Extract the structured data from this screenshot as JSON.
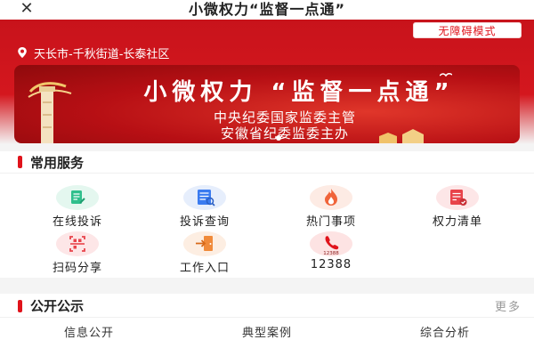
{
  "header": {
    "close_icon": "close-icon",
    "title": "小微权力“监督一点通”",
    "menu_icon": "more-dots-icon"
  },
  "toolbar": {
    "accessibility_label": "无障碍模式"
  },
  "location": {
    "icon": "location-pin-icon",
    "text": "天长市-千秋街道-长泰社区"
  },
  "banner": {
    "title": "小微权力 “监督一点通”",
    "subtitle_line1": "中央纪委国家监委主管",
    "subtitle_line2": "安徽省纪委监委主办",
    "active_slide": 1,
    "slide_count": 1
  },
  "services": {
    "section_title": "常用服务",
    "items": [
      {
        "label": "在线投诉",
        "icon": "complaint-form-icon",
        "color": "#2fbf8c",
        "bg": "#e4f7ef"
      },
      {
        "label": "投诉查询",
        "icon": "search-list-icon",
        "color": "#3a7bf0",
        "bg": "#e6eefc"
      },
      {
        "label": "热门事项",
        "icon": "flame-icon",
        "color": "#f0643a",
        "bg": "#fdebe4"
      },
      {
        "label": "权力清单",
        "icon": "checklist-icon",
        "color": "#e8434a",
        "bg": "#fde6e7"
      },
      {
        "label": "扫码分享",
        "icon": "qr-scan-icon",
        "color": "#e8434a",
        "bg": "#fde6e7"
      },
      {
        "label": "工作入口",
        "icon": "door-enter-icon",
        "color": "#f08a3a",
        "bg": "#fdeee2"
      },
      {
        "label": "12388",
        "icon": "hotline-phone-icon",
        "color": "#e0131b",
        "bg": "#fde3e3",
        "icon_caption": "12388"
      }
    ]
  },
  "notice": {
    "section_title": "公开公示",
    "more_label": "更多",
    "tabs": [
      {
        "label": "信息公开",
        "active": true
      },
      {
        "label": "典型案例",
        "active": false
      },
      {
        "label": "综合分析",
        "active": false
      }
    ]
  },
  "colors": {
    "brand_red": "#e0131b",
    "header_red": "#c8131b"
  }
}
